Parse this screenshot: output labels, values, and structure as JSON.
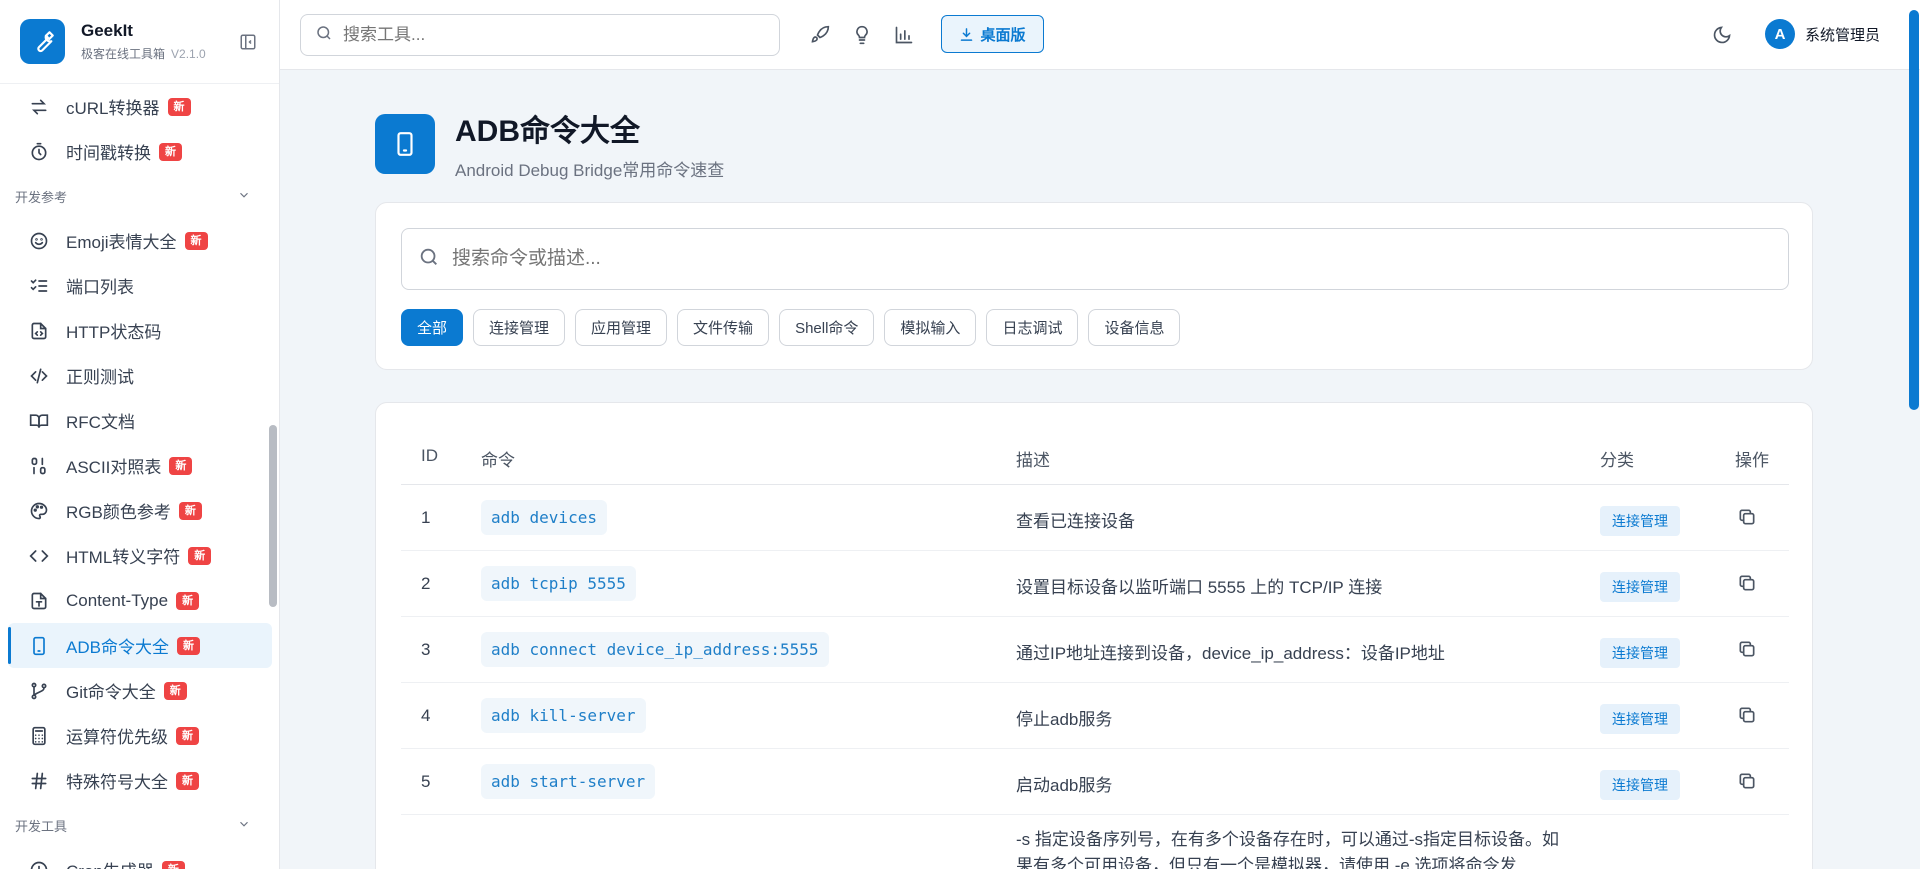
{
  "brand": {
    "name": "GeekIt",
    "subtitle": "极客在线工具箱",
    "version": "V2.1.0"
  },
  "sidebar": {
    "items_top": [
      {
        "label": "cURL转换器",
        "badge": "新",
        "icon": "arrows-swap-icon"
      },
      {
        "label": "时间戳转换",
        "badge": "新",
        "icon": "timer-icon"
      }
    ],
    "group_ref": "开发参考",
    "items_ref": [
      {
        "label": "Emoji表情大全",
        "badge": "新",
        "icon": "smile-icon"
      },
      {
        "label": "端口列表",
        "badge": "",
        "icon": "list-check-icon"
      },
      {
        "label": "HTTP状态码",
        "badge": "",
        "icon": "file-code-icon"
      },
      {
        "label": "正则测试",
        "badge": "",
        "icon": "code-slash-icon"
      },
      {
        "label": "RFC文档",
        "badge": "",
        "icon": "book-icon"
      },
      {
        "label": "ASCII对照表",
        "badge": "新",
        "icon": "binary-icon"
      },
      {
        "label": "RGB颜色参考",
        "badge": "新",
        "icon": "palette-icon"
      },
      {
        "label": "HTML转义字符",
        "badge": "新",
        "icon": "code-brackets-icon"
      },
      {
        "label": "Content-Type",
        "badge": "新",
        "icon": "file-type-icon"
      },
      {
        "label": "ADB命令大全",
        "badge": "新",
        "icon": "phone-icon",
        "active": true
      },
      {
        "label": "Git命令大全",
        "badge": "新",
        "icon": "git-branch-icon"
      },
      {
        "label": "运算符优先级",
        "badge": "新",
        "icon": "calculator-icon"
      },
      {
        "label": "特殊符号大全",
        "badge": "新",
        "icon": "hash-icon"
      }
    ],
    "group_tools": "开发工具",
    "items_tools_partial": [
      {
        "label": "Cron生成器",
        "badge": "新",
        "icon": "clock-icon"
      }
    ]
  },
  "topbar": {
    "search_placeholder": "搜索工具...",
    "desktop_label": "桌面版",
    "user_initial": "A",
    "user_name": "系统管理员"
  },
  "page": {
    "title": "ADB命令大全",
    "subtitle": "Android Debug Bridge常用命令速查",
    "search_placeholder": "搜索命令或描述...",
    "filters": [
      "全部",
      "连接管理",
      "应用管理",
      "文件传输",
      "Shell命令",
      "模拟输入",
      "日志调试",
      "设备信息"
    ],
    "active_filter": "全部"
  },
  "table": {
    "headers": {
      "id": "ID",
      "cmd": "命令",
      "desc": "描述",
      "cat": "分类",
      "op": "操作"
    },
    "rows": [
      {
        "id": "1",
        "cmd": "adb devices",
        "desc": "查看已连接设备",
        "cat": "连接管理"
      },
      {
        "id": "2",
        "cmd": "adb tcpip 5555",
        "desc": "设置目标设备以监听端口 5555 上的 TCP/IP 连接",
        "cat": "连接管理"
      },
      {
        "id": "3",
        "cmd": "adb connect device_ip_address:5555",
        "desc": "通过IP地址连接到设备，device_ip_address：设备IP地址",
        "cat": "连接管理"
      },
      {
        "id": "4",
        "cmd": "adb kill-server",
        "desc": "停止adb服务",
        "cat": "连接管理"
      },
      {
        "id": "5",
        "cmd": "adb start-server",
        "desc": "启动adb服务",
        "cat": "连接管理"
      },
      {
        "id": "",
        "cmd": "",
        "desc": "-s 指定设备序列号，在有多个设备存在时，可以通过-s指定目标设备。如果有多个可用设备，但只有一个是模拟器，请使用 -e 选项将命令发",
        "cat": ""
      }
    ]
  },
  "colors": {
    "accent": "#0b7ad1",
    "badge": "#ef4444"
  }
}
